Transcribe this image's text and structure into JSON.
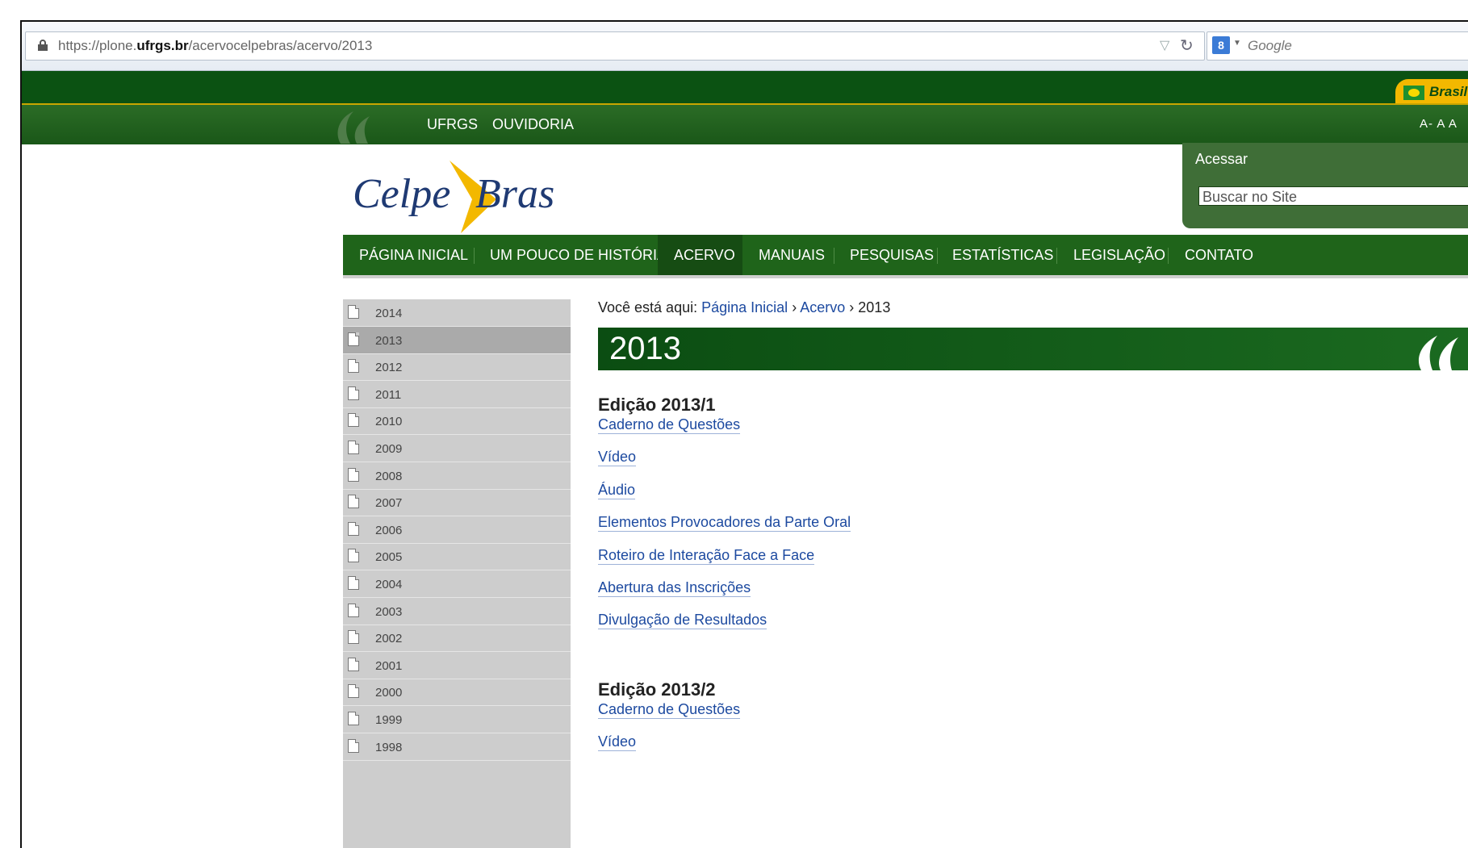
{
  "browser": {
    "url_prefix": "https://plone.",
    "url_domain": "ufrgs.br",
    "url_path": "/acervocelpebras/acervo/2013",
    "search_engine_label": "Google"
  },
  "top": {
    "brasil_label": "Brasil",
    "util_links": [
      "UFRGS",
      "OUVIDORIA"
    ],
    "font_size_controls": "A-  A  A"
  },
  "header": {
    "logo_text_1": "Celpe",
    "logo_text_2": "Bras",
    "login_label": "Acessar",
    "search_placeholder": "Buscar no Site"
  },
  "nav": {
    "items": [
      "PÁGINA INICIAL",
      "UM POUCO DE HISTÓRIA",
      "ACERVO",
      "MANUAIS",
      "PESQUISAS",
      "ESTATÍSTICAS",
      "LEGISLAÇÃO",
      "CONTATO"
    ],
    "active": "ACERVO"
  },
  "sidebar": {
    "items": [
      "2014",
      "2013",
      "2012",
      "2011",
      "2010",
      "2009",
      "2008",
      "2007",
      "2006",
      "2005",
      "2004",
      "2003",
      "2002",
      "2001",
      "2000",
      "1999",
      "1998"
    ],
    "active": "2013"
  },
  "breadcrumb": {
    "prefix": "Você está aqui:",
    "home": "Página Inicial",
    "sep": "›",
    "section": "Acervo",
    "current": "2013"
  },
  "page": {
    "title": "2013",
    "editions": [
      {
        "heading": "Edição 2013/1",
        "links": [
          "Caderno de Questões",
          "Vídeo",
          "Áudio",
          "Elementos Provocadores da Parte Oral",
          "Roteiro de Interação Face a Face",
          "Abertura das Inscrições",
          "Divulgação de Resultados"
        ]
      },
      {
        "heading": "Edição 2013/2",
        "links": [
          "Caderno de Questões",
          "Vídeo"
        ]
      }
    ]
  },
  "colors": {
    "dark_green": "#0b5212",
    "nav_green": "#1f641a",
    "gold": "#f3b800",
    "link_blue": "#1d4aa0",
    "sidebar_gray": "#cdcdcd"
  }
}
